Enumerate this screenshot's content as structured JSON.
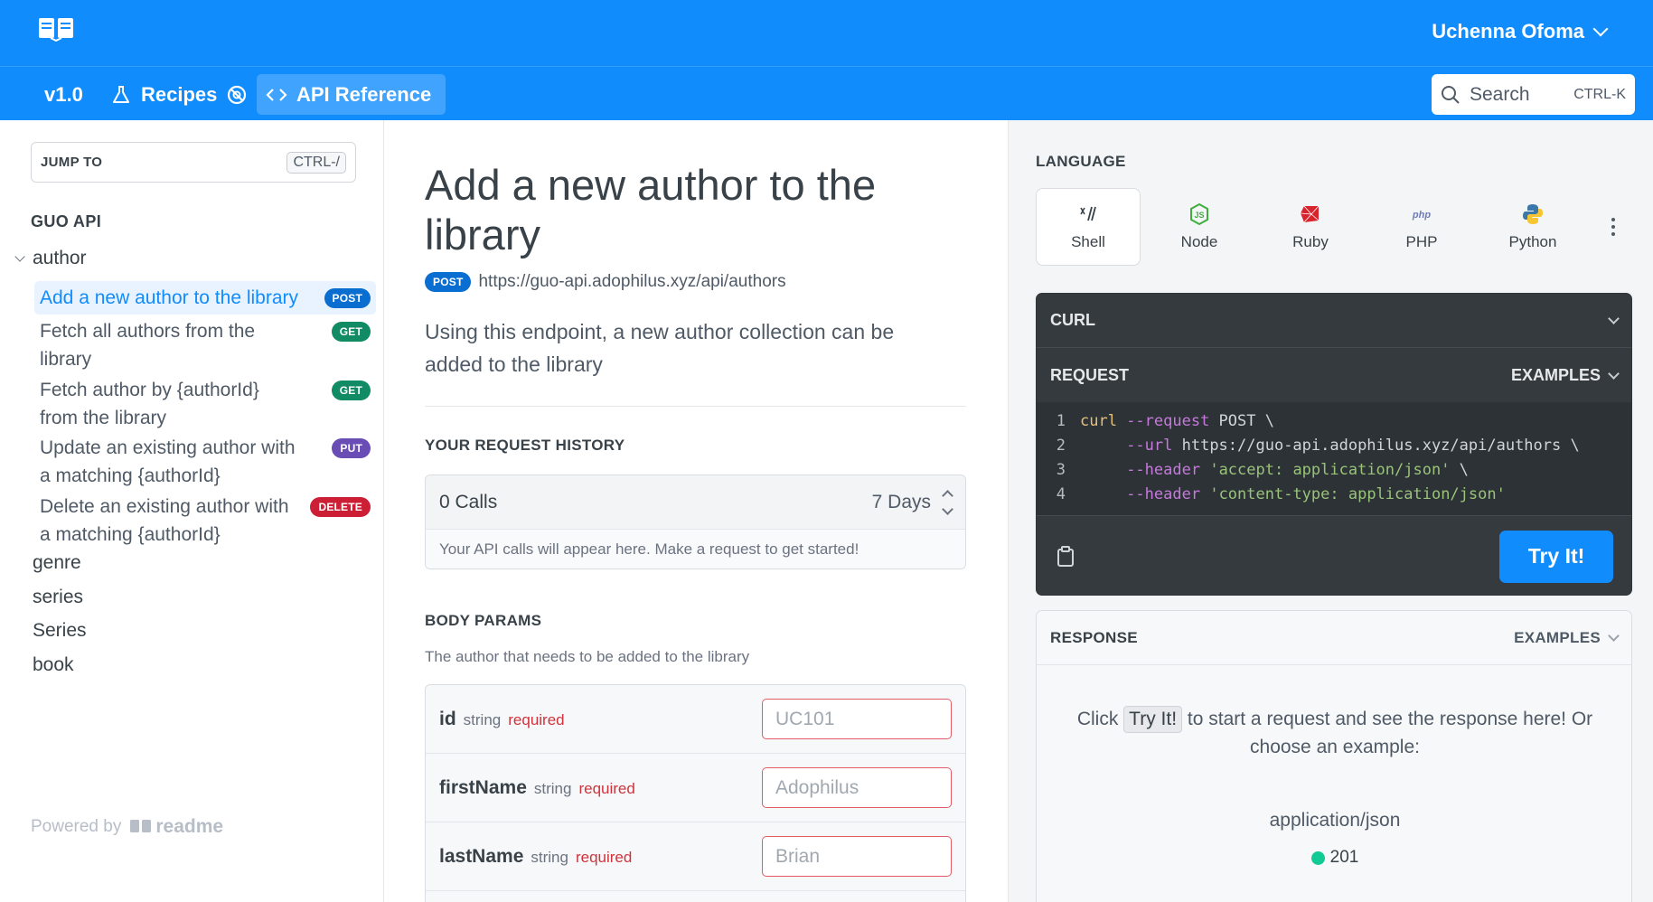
{
  "header": {
    "user_name": "Uchenna Ofoma"
  },
  "nav": {
    "version": "v1.0",
    "recipes": "Recipes",
    "api_reference": "API Reference",
    "search_placeholder": "Search",
    "search_shortcut": "CTRL-K"
  },
  "sidebar": {
    "jump_label": "JUMP TO",
    "jump_shortcut": "CTRL-/",
    "heading": "GUO API",
    "author_group": "author",
    "endpoints": [
      {
        "label": "Add a new author to the library",
        "method": "POST",
        "active": true
      },
      {
        "label": "Fetch all authors from the library",
        "method": "GET",
        "active": false
      },
      {
        "label": "Fetch author by {authorId} from the library",
        "method": "GET",
        "active": false
      },
      {
        "label": "Update an existing author with a matching {authorId}",
        "method": "PUT",
        "active": false
      },
      {
        "label": "Delete an existing author with a matching {authorId}",
        "method": "DELETE",
        "active": false
      }
    ],
    "groups": [
      "genre",
      "series",
      "Series",
      "book"
    ],
    "powered_by": "Powered by",
    "brand": "readme"
  },
  "main": {
    "title": "Add a new author to the library",
    "method": "POST",
    "url": "https://guo-api.adophilus.xyz/api/authors",
    "description": "Using this endpoint, a new author collection can be added to the library",
    "history_title": "YOUR REQUEST HISTORY",
    "history_calls": "0 Calls",
    "history_range": "7 Days",
    "history_empty": "Your API calls will appear here. Make a request to get started!",
    "body_title": "BODY PARAMS",
    "body_desc": "The author that needs to be added to the library",
    "params": [
      {
        "name": "id",
        "type": "string",
        "required": "required",
        "value": "UC101"
      },
      {
        "name": "firstName",
        "type": "string",
        "required": "required",
        "value": "Adophilus"
      },
      {
        "name": "lastName",
        "type": "string",
        "required": "required",
        "value": "Brian"
      }
    ]
  },
  "right": {
    "language_label": "LANGUAGE",
    "languages": [
      "Shell",
      "Node",
      "Ruby",
      "PHP",
      "Python"
    ],
    "curl_label": "CURL",
    "request_label": "REQUEST",
    "examples_label": "EXAMPLES",
    "code": [
      {
        "n": "1",
        "cmd": "curl",
        "flag": " --request",
        "rest": " POST \\",
        "str": ""
      },
      {
        "n": "2",
        "cmd": "     ",
        "flag": "--url",
        "rest": " https://guo-api.adophilus.xyz/api/authors \\",
        "str": ""
      },
      {
        "n": "3",
        "cmd": "     ",
        "flag": "--header",
        "rest": " ",
        "str": "'accept: application/json'",
        "tail": " \\"
      },
      {
        "n": "4",
        "cmd": "     ",
        "flag": "--header",
        "rest": " ",
        "str": "'content-type: application/json'"
      }
    ],
    "try_button": "Try It!",
    "response_label": "RESPONSE",
    "response_examples": "EXAMPLES",
    "response_msg_pre": "Click",
    "response_msg_btn": "Try It!",
    "response_msg_post": "to start a request and see the response here! Or choose an example:",
    "response_type": "application/json",
    "response_status": "201",
    "status_color": "#12ca93"
  },
  "colors": {
    "brand": "#118cfd",
    "post": "#0a6ed1",
    "get": "#108b63",
    "put": "#6a4cb5",
    "delete": "#cc1f35"
  }
}
